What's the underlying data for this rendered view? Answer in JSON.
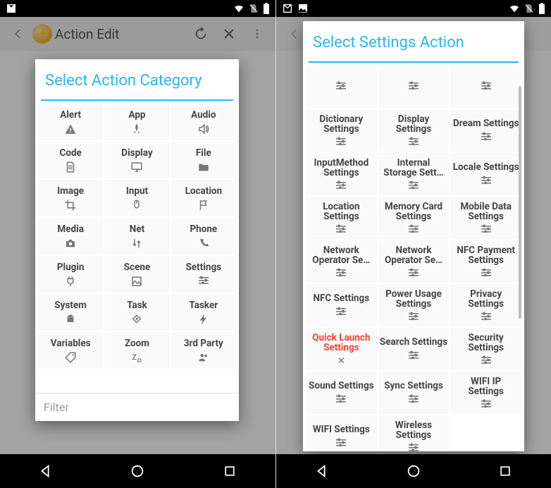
{
  "left": {
    "statusbar": {
      "icons": [
        "email",
        "wifi",
        "no-sim",
        "battery"
      ]
    },
    "appbar": {
      "title": "Action Edit"
    },
    "dialog": {
      "title": "Select Action Category",
      "filter_placeholder": "Filter",
      "items": [
        {
          "label": "Alert",
          "icon": "warning-icon"
        },
        {
          "label": "App",
          "icon": "rocket-icon"
        },
        {
          "label": "Audio",
          "icon": "speaker-icon"
        },
        {
          "label": "Code",
          "icon": "document-icon"
        },
        {
          "label": "Display",
          "icon": "monitor-icon"
        },
        {
          "label": "File",
          "icon": "folder-icon"
        },
        {
          "label": "Image",
          "icon": "crop-icon"
        },
        {
          "label": "Input",
          "icon": "mouse-icon"
        },
        {
          "label": "Location",
          "icon": "flag-icon"
        },
        {
          "label": "Media",
          "icon": "camera-icon"
        },
        {
          "label": "Net",
          "icon": "swap-vertical-icon"
        },
        {
          "label": "Phone",
          "icon": "phone-icon"
        },
        {
          "label": "Plugin",
          "icon": "plug-icon"
        },
        {
          "label": "Scene",
          "icon": "picture-icon"
        },
        {
          "label": "Settings",
          "icon": "tune-icon"
        },
        {
          "label": "System",
          "icon": "android-icon"
        },
        {
          "label": "Task",
          "icon": "diamond-icon"
        },
        {
          "label": "Tasker",
          "icon": "lightning-icon"
        },
        {
          "label": "Variables",
          "icon": "tag-icon"
        },
        {
          "label": "Zoom",
          "icon": "zoom-icon"
        },
        {
          "label": "3rd Party",
          "icon": "group-icon"
        }
      ]
    }
  },
  "right": {
    "statusbar": {
      "icons": [
        "email",
        "picture",
        "wifi",
        "no-sim",
        "battery"
      ]
    },
    "dialog": {
      "title": "Select Settings Action",
      "items": [
        {
          "label": "",
          "icon": "tune-icon",
          "toprow": true
        },
        {
          "label": "",
          "icon": "tune-icon",
          "toprow": true
        },
        {
          "label": "",
          "icon": "tune-icon",
          "toprow": true
        },
        {
          "label": "Dictionary Settings",
          "icon": "tune-icon"
        },
        {
          "label": "Display Settings",
          "icon": "tune-icon"
        },
        {
          "label": "Dream Settings",
          "icon": "tune-icon"
        },
        {
          "label": "InputMethod Settings",
          "icon": "tune-icon"
        },
        {
          "label": "Internal Storage Sett…",
          "icon": "tune-icon"
        },
        {
          "label": "Locale Settings",
          "icon": "tune-icon"
        },
        {
          "label": "Location Settings",
          "icon": "tune-icon"
        },
        {
          "label": "Memory Card Settings",
          "icon": "tune-icon"
        },
        {
          "label": "Mobile Data Settings",
          "icon": "tune-icon"
        },
        {
          "label": "Network Operator Se…",
          "icon": "tune-icon"
        },
        {
          "label": "Network Operator Se…",
          "icon": "tune-icon"
        },
        {
          "label": "NFC Payment Settings",
          "icon": "tune-icon"
        },
        {
          "label": "NFC Settings",
          "icon": "tune-icon"
        },
        {
          "label": "Power Usage Settings",
          "icon": "tune-icon"
        },
        {
          "label": "Privacy Settings",
          "icon": "tune-icon"
        },
        {
          "label": "Quick Launch Settings",
          "icon": "x-icon",
          "highlight": true
        },
        {
          "label": "Search Settings",
          "icon": "tune-icon"
        },
        {
          "label": "Security Settings",
          "icon": "tune-icon"
        },
        {
          "label": "Sound Settings",
          "icon": "tune-icon"
        },
        {
          "label": "Sync Settings",
          "icon": "tune-icon"
        },
        {
          "label": "WIFI IP Settings",
          "icon": "tune-icon"
        },
        {
          "label": "WIFI Settings",
          "icon": "tune-icon"
        },
        {
          "label": "Wireless Settings",
          "icon": "tune-icon"
        },
        {
          "label": "",
          "icon": "",
          "empty": true
        }
      ]
    }
  }
}
